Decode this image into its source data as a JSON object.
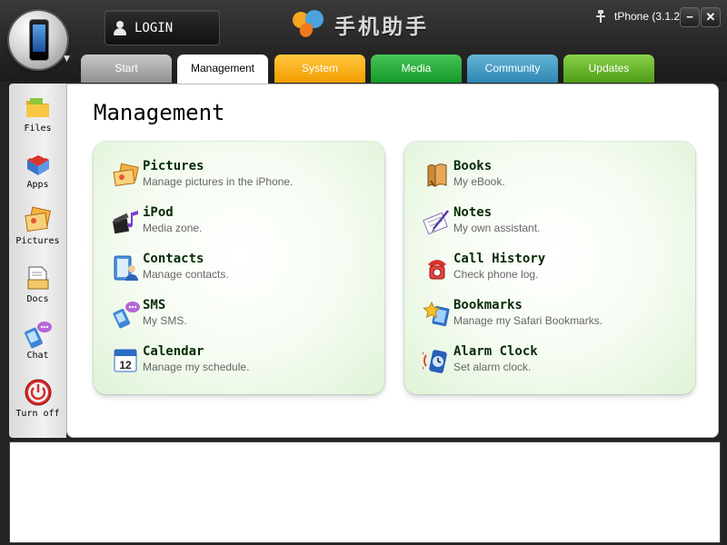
{
  "app": {
    "logo_text": "手机助手"
  },
  "header": {
    "login_label": "LOGIN",
    "device_label": "tPhone (3.1.2)",
    "minimize_label": "−",
    "close_label": "✕"
  },
  "tabs": [
    {
      "label": "Start",
      "color": "#a8a8a8"
    },
    {
      "label": "Management",
      "color": "#ffffff",
      "active": true
    },
    {
      "label": "System",
      "color": "#f6a800"
    },
    {
      "label": "Media",
      "color": "#1fae38"
    },
    {
      "label": "Community",
      "color": "#3d97c4"
    },
    {
      "label": "Updates",
      "color": "#62b324"
    }
  ],
  "sidebar": {
    "items": [
      {
        "label": "Files",
        "icon": "folder-icon"
      },
      {
        "label": "Apps",
        "icon": "apps-icon"
      },
      {
        "label": "Pictures",
        "icon": "pictures-icon"
      },
      {
        "label": "Docs",
        "icon": "docs-icon"
      },
      {
        "label": "Chat",
        "icon": "chat-icon"
      },
      {
        "label": "Turn off",
        "icon": "power-icon"
      }
    ]
  },
  "main": {
    "title": "Management",
    "left_items": [
      {
        "title": "Pictures",
        "desc": "Manage pictures in the iPhone.",
        "icon": "pictures-icon"
      },
      {
        "title": "iPod",
        "desc": "Media zone.",
        "icon": "music-icon"
      },
      {
        "title": "Contacts",
        "desc": "Manage contacts.",
        "icon": "contacts-icon"
      },
      {
        "title": "SMS",
        "desc": "My SMS.",
        "icon": "sms-icon"
      },
      {
        "title": "Calendar",
        "desc": "Manage my schedule.",
        "icon": "calendar-icon"
      }
    ],
    "right_items": [
      {
        "title": "Books",
        "desc": "My eBook.",
        "icon": "book-icon"
      },
      {
        "title": "Notes",
        "desc": "My own assistant.",
        "icon": "notes-icon"
      },
      {
        "title": "Call History",
        "desc": "Check phone log.",
        "icon": "phone-icon"
      },
      {
        "title": "Bookmarks",
        "desc": "Manage my Safari Bookmarks.",
        "icon": "bookmark-icon"
      },
      {
        "title": "Alarm Clock",
        "desc": "Set alarm clock.",
        "icon": "alarm-icon"
      }
    ],
    "calendar_day": "12"
  }
}
